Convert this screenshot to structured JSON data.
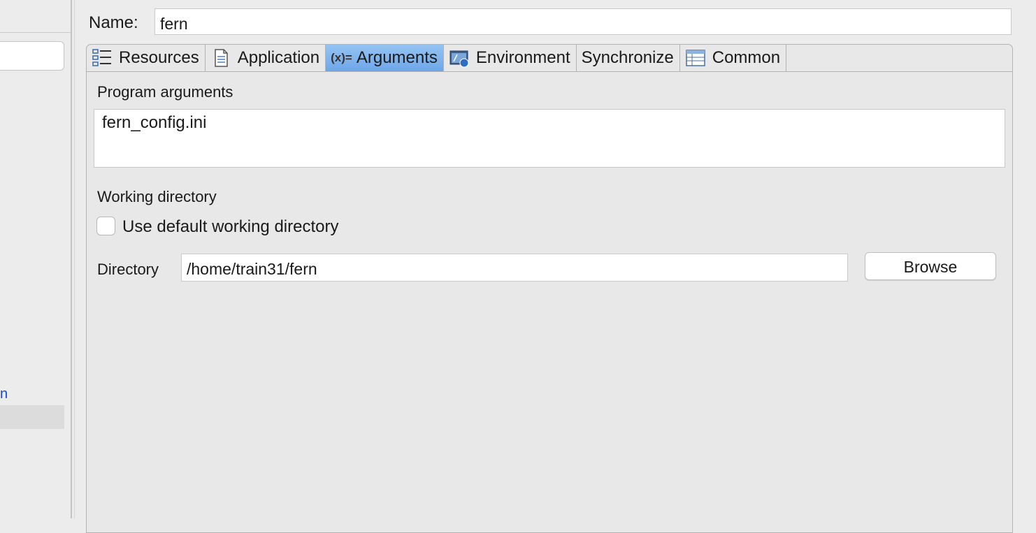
{
  "sidebar": {
    "fragment_text": "n"
  },
  "name": {
    "label": "Name:",
    "value": "fern"
  },
  "tabs": [
    {
      "label": "Resources",
      "icon": "resources-icon",
      "active": false
    },
    {
      "label": "Application",
      "icon": "application-icon",
      "active": false
    },
    {
      "label": "Arguments",
      "icon": "arguments-icon",
      "icon_text": "(x)=",
      "active": true
    },
    {
      "label": "Environment",
      "icon": "environment-icon",
      "active": false
    },
    {
      "label": "Synchronize",
      "icon": "",
      "active": false
    },
    {
      "label": "Common",
      "icon": "common-icon",
      "active": false
    }
  ],
  "arguments": {
    "program_label": "Program arguments",
    "program_value": "fern_config.ini",
    "working_dir_label": "Working directory",
    "use_default_label": "Use default working directory",
    "use_default_checked": false,
    "directory_label": "Directory",
    "directory_value": "/home/train31/fern",
    "browse_label": "Browse"
  },
  "colors": {
    "active_tab": "#7fb2ec",
    "background": "#ececec"
  }
}
